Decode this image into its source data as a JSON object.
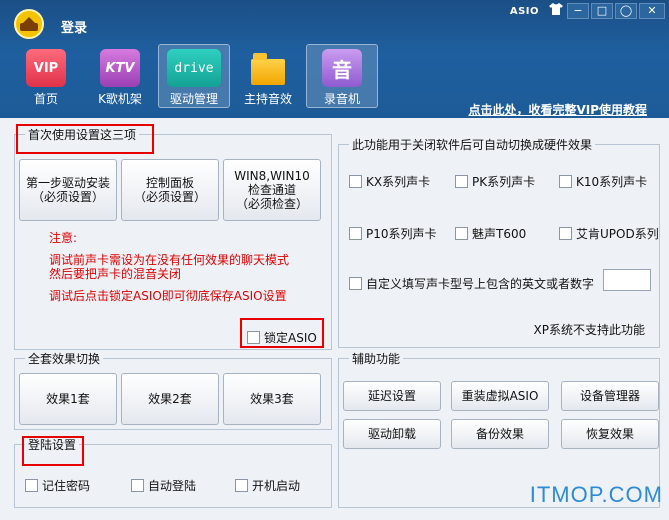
{
  "header": {
    "login_label": "登录",
    "asio_label": "ASIO",
    "minimize": "−",
    "maximize": "□",
    "feedback": "◯",
    "close": "✕",
    "vip_link": "点击此处，收看完整VIP使用教程"
  },
  "toolbar": [
    {
      "icon_text": "VIP",
      "label": "首页"
    },
    {
      "icon_text": "KTV",
      "label": "K歌机架"
    },
    {
      "icon_text": "drive",
      "label": "驱动管理"
    },
    {
      "icon_text": "",
      "label": "主持音效"
    },
    {
      "icon_text": "音",
      "label": "录音机"
    }
  ],
  "setup": {
    "title": "首次使用设置这三项",
    "btn1": "第一步驱动安装\n（必须设置）",
    "btn2": "控制面板\n（必须设置）",
    "btn3": "WIN8,WIN10\n检查通道\n（必须检查）",
    "note_title": "注意:",
    "note1": "调试前声卡需设为在没有任何效果的聊天模式\n然后要把声卡的混音关闭",
    "note2": "调试后点击锁定ASIO即可彻底保存ASIO设置",
    "lock_asio": "锁定ASIO"
  },
  "hardware": {
    "title": "此功能用于关闭软件后可自动切换成硬件效果",
    "cards": [
      "KX系列声卡",
      "PK系列声卡",
      "K10系列声卡",
      "P10系列声卡",
      "魅声T600",
      "艾肯UPOD系列"
    ],
    "custom_label": "自定义填写声卡型号上包含的英文或者数字",
    "xp_note": "XP系统不支持此功能"
  },
  "effects": {
    "title": "全套效果切换",
    "buttons": [
      "效果1套",
      "效果2套",
      "效果3套"
    ]
  },
  "assist": {
    "title": "辅助功能",
    "buttons": [
      "延迟设置",
      "重装虚拟ASIO",
      "设备管理器",
      "驱动卸载",
      "备份效果",
      "恢复效果"
    ]
  },
  "login": {
    "title": "登陆设置",
    "options": [
      "记住密码",
      "自动登陆",
      "开机启动"
    ]
  },
  "watermark": "ITMOP.COM"
}
